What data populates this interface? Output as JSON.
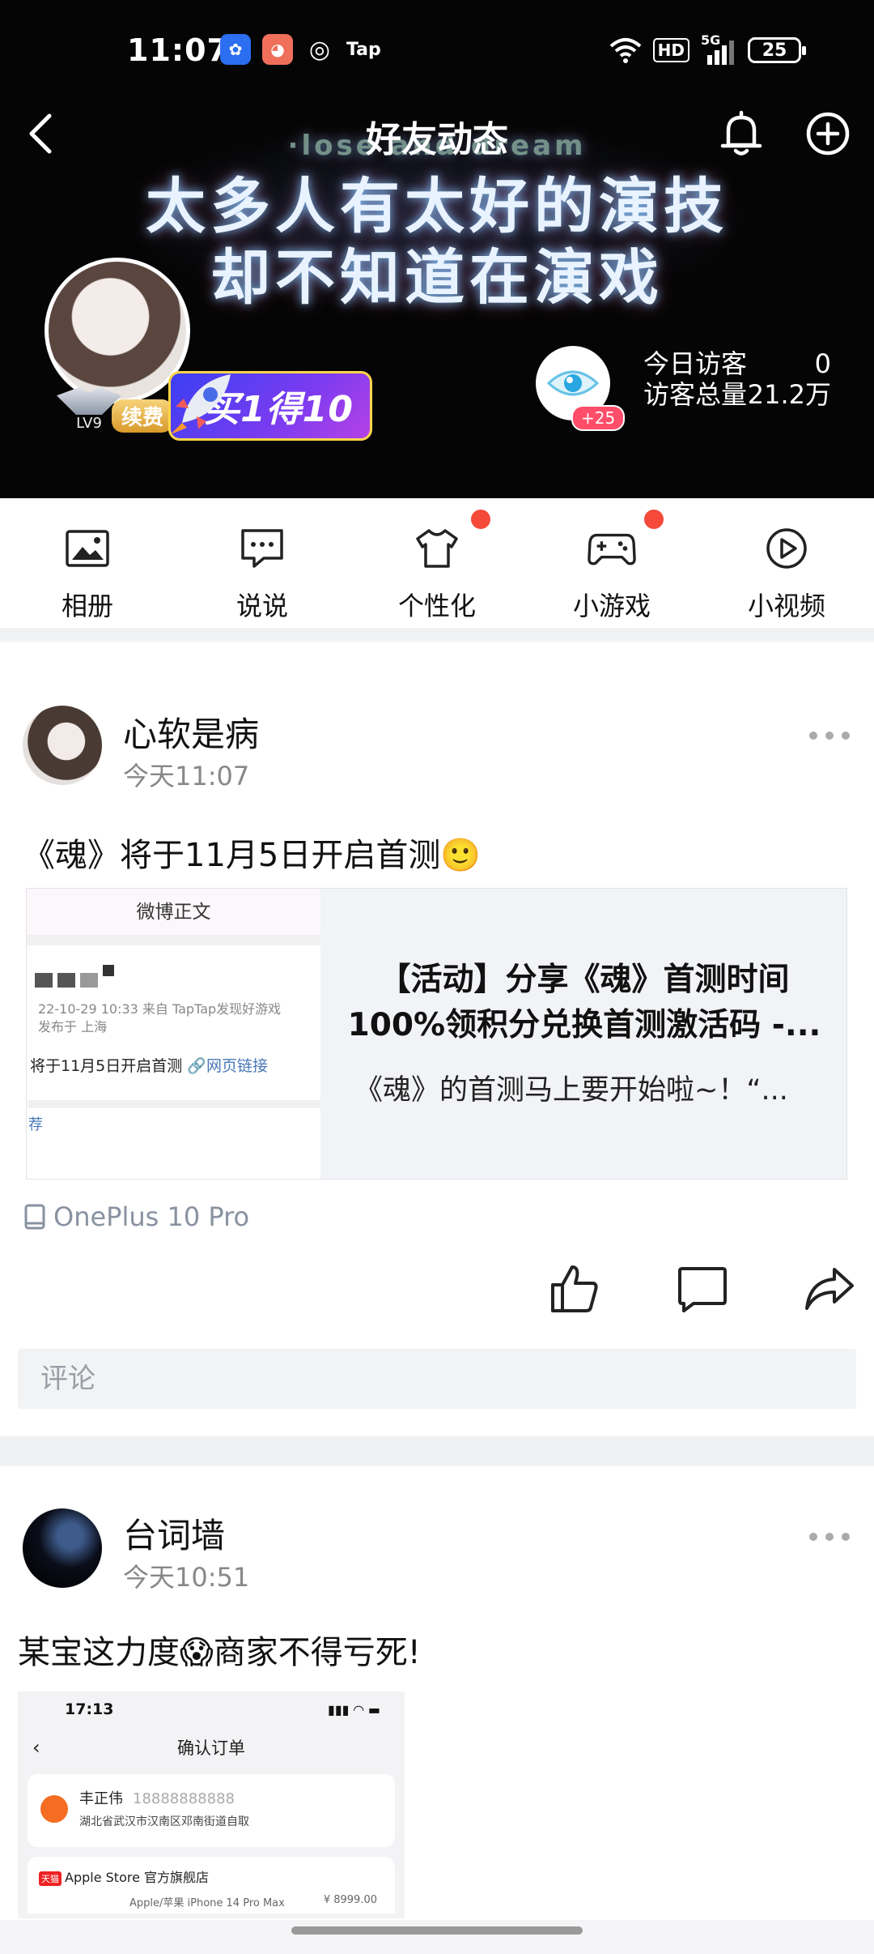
{
  "status_bar": {
    "time": "11:07",
    "apps": [
      "baidu-icon",
      "game-cat-icon",
      "weibo-icon",
      "Tap"
    ],
    "hd": "HD",
    "network": "5G",
    "battery": "25"
  },
  "header": {
    "title": "好友动态",
    "cover_subtitle": "·lose and dream",
    "cover_line1": "太多人有太好的演技",
    "cover_line2": "却不知道在演戏",
    "level": "LV9",
    "renew": "续费",
    "promo": "买1得10",
    "visitors_plus": "+25",
    "today_visitors_label": "今日访客",
    "today_visitors_value": "0",
    "total_visitors_label": "访客总量",
    "total_visitors_value": "21.2万"
  },
  "quick_nav": [
    {
      "label": "相册",
      "icon": "photo-icon",
      "dot": false
    },
    {
      "label": "说说",
      "icon": "message-icon",
      "dot": false
    },
    {
      "label": "个性化",
      "icon": "tshirt-icon",
      "dot": true
    },
    {
      "label": "小游戏",
      "icon": "gamepad-icon",
      "dot": true
    },
    {
      "label": "小视频",
      "icon": "play-icon",
      "dot": false
    }
  ],
  "posts": [
    {
      "name": "心软是病",
      "time": "今天11:07",
      "text": "《魂》将于11月5日开启首测🙂",
      "link": {
        "thumb_header": "微博正文",
        "thumb_meta1": "22-10-29 10:33  来自 TapTap发现好游戏",
        "thumb_meta2": "发布于 上海",
        "thumb_body": "将于11月5日开启首测",
        "thumb_link": "🔗网页链接",
        "thumb_rec": "荐",
        "title_line1": "【活动】分享《魂》首测时间",
        "title_line2": "100%领积分兑换首测激活码 -...",
        "desc": "《魂》的首测马上要开始啦~！“..."
      },
      "device": "OnePlus 10 Pro",
      "comment_placeholder": "评论"
    },
    {
      "name": "台词墙",
      "time": "今天10:51",
      "text": "某宝这力度😱商家不得亏死!",
      "shot": {
        "time": "17:13",
        "title": "确认订单",
        "contact_name": "丰正伟",
        "contact_phone": "18888888888",
        "address": "湖北省武汉市汉南区邓南街道自取",
        "store_tag": "天猫",
        "store": "Apple Store 官方旗舰店",
        "product": "Apple/苹果 iPhone 14 Pro Max",
        "price": "¥ 8999.00"
      }
    }
  ],
  "colors": {
    "accent_red": "#f5493a",
    "cover_bg": "#050505",
    "muted_text": "#888888"
  }
}
